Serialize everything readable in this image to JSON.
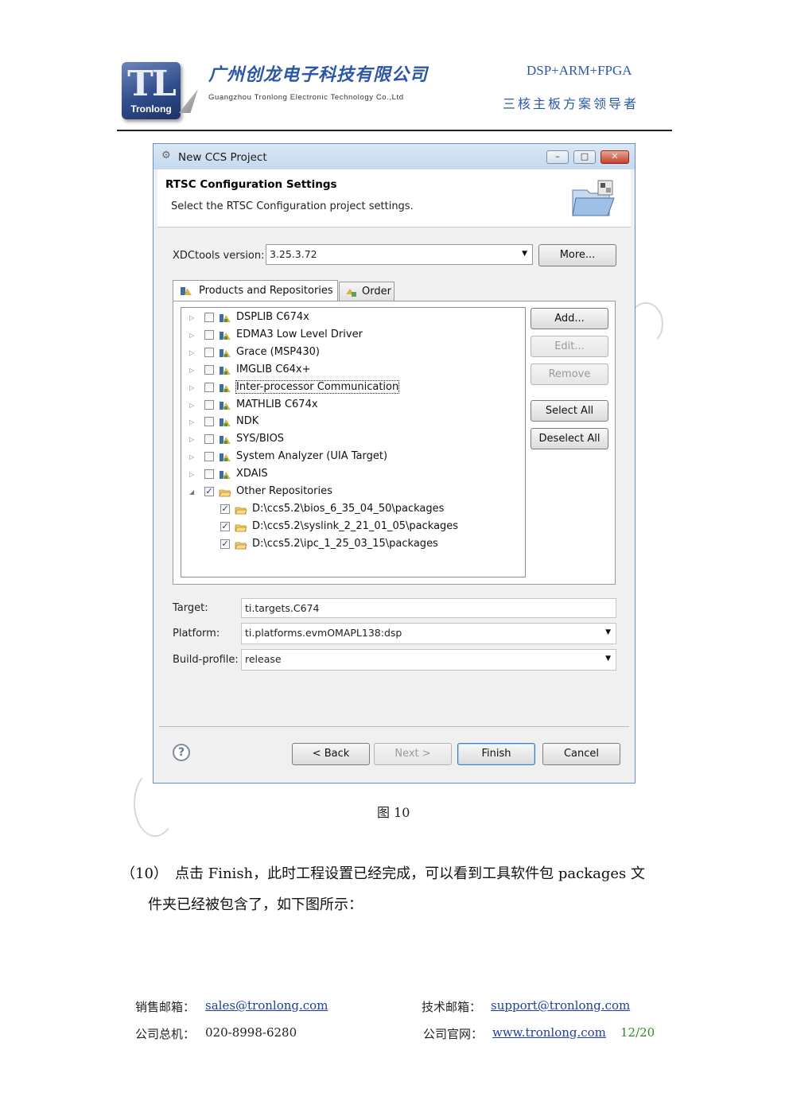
{
  "header": {
    "logo_letters": "TL",
    "logo_name": "Tronlong",
    "company_cn": "广州创龙电子科技有限公司",
    "company_en": "Guangzhou Tronlong Electronic Technology Co.,Ltd",
    "tagline1": "DSP+ARM+FPGA",
    "tagline2": "三核主板方案领导者"
  },
  "dialog": {
    "title": "New CCS Project",
    "window_buttons": {
      "minimize": "–",
      "maximize": "□",
      "close": "✕"
    },
    "banner_title": "RTSC Configuration Settings",
    "banner_subtitle": "Select the RTSC Configuration project settings.",
    "xdc_label": "XDCtools version:",
    "xdc_value": "3.25.3.72",
    "more_button": "More...",
    "tabs": [
      {
        "label": "Products and Repositories",
        "icon": "products-icon"
      },
      {
        "label": "Order",
        "icon": "order-icon"
      }
    ],
    "tree_items": [
      {
        "label": "DSPLIB C674x",
        "checked": false,
        "expanded": false,
        "level": 0,
        "icon": "package-icon"
      },
      {
        "label": "EDMA3 Low Level Driver",
        "checked": false,
        "expanded": false,
        "level": 0,
        "icon": "package-icon"
      },
      {
        "label": "Grace (MSP430)",
        "checked": false,
        "expanded": false,
        "level": 0,
        "icon": "package-icon"
      },
      {
        "label": "IMGLIB C64x+",
        "checked": false,
        "expanded": false,
        "level": 0,
        "icon": "package-icon"
      },
      {
        "label": "Inter-processor Communication",
        "checked": false,
        "expanded": false,
        "level": 0,
        "icon": "package-icon",
        "focused": true
      },
      {
        "label": "MATHLIB C674x",
        "checked": false,
        "expanded": false,
        "level": 0,
        "icon": "package-icon"
      },
      {
        "label": "NDK",
        "checked": false,
        "expanded": false,
        "level": 0,
        "icon": "package-icon"
      },
      {
        "label": "SYS/BIOS",
        "checked": false,
        "expanded": false,
        "level": 0,
        "icon": "package-icon"
      },
      {
        "label": "System Analyzer (UIA Target)",
        "checked": false,
        "expanded": false,
        "level": 0,
        "icon": "package-icon"
      },
      {
        "label": "XDAIS",
        "checked": false,
        "expanded": false,
        "level": 0,
        "icon": "package-icon"
      },
      {
        "label": "Other Repositories",
        "checked": true,
        "expanded": true,
        "level": 0,
        "icon": "repository-folder-icon"
      },
      {
        "label": "D:\\ccs5.2\\bios_6_35_04_50\\packages",
        "checked": true,
        "level": 1,
        "icon": "open-folder-icon"
      },
      {
        "label": "D:\\ccs5.2\\syslink_2_21_01_05\\packages",
        "checked": true,
        "level": 1,
        "icon": "open-folder-icon"
      },
      {
        "label": "D:\\ccs5.2\\ipc_1_25_03_15\\packages",
        "checked": true,
        "level": 1,
        "icon": "open-folder-icon"
      }
    ],
    "side_buttons": [
      {
        "label": "Add...",
        "enabled": true
      },
      {
        "label": "Edit...",
        "enabled": false
      },
      {
        "label": "Remove",
        "enabled": false
      },
      {
        "label": "Select All",
        "enabled": true
      },
      {
        "label": "Deselect All",
        "enabled": true
      }
    ],
    "target_label": "Target:",
    "target_value": "ti.targets.C674",
    "platform_label": "Platform:",
    "platform_value": "ti.platforms.evmOMAPL138:dsp",
    "buildprofile_label": "Build-profile:",
    "buildprofile_value": "release",
    "help_glyph": "?",
    "nav_buttons": {
      "back": "< Back",
      "next": "Next >",
      "finish": "Finish",
      "cancel": "Cancel"
    }
  },
  "caption": "图 10",
  "paragraph": {
    "number": "（10）",
    "line1": "点击 Finish，此时工程设置已经完成，可以看到工具软件包 packages 文",
    "line2": "件夹已经被包含了，如下图所示："
  },
  "footer": {
    "sales_label": "销售邮箱：",
    "sales_email": "sales@tronlong.com",
    "support_label": "技术邮箱：",
    "support_email": "support@tronlong.com",
    "phone_label": "公司总机：",
    "phone": "020-8998-6280",
    "website_label": "公司官网：",
    "website": "www.tronlong.com",
    "page": "12/20"
  },
  "colors": {
    "brand_blue": "#2b57a8",
    "link": "#1f3f9f",
    "page_number": "#2f8a2f",
    "dialog_border": "#6a8fbf"
  }
}
